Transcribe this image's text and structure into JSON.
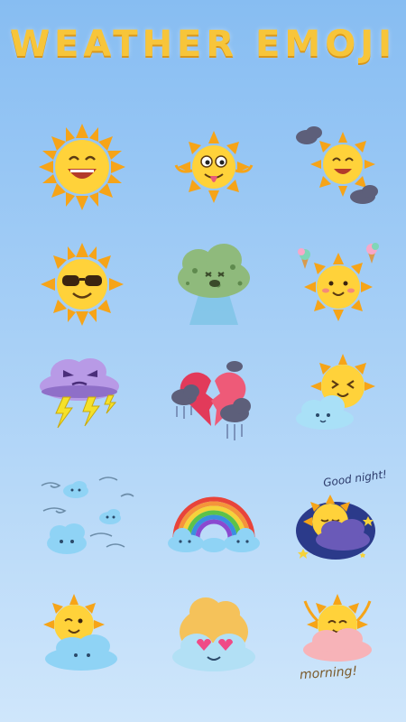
{
  "header": {
    "title": "WEATHER EMOJI"
  },
  "stickers": [
    {
      "name": "laughing-sun"
    },
    {
      "name": "silly-tongue-sun"
    },
    {
      "name": "sun-with-storm-clouds"
    },
    {
      "name": "cool-sunglasses-sun"
    },
    {
      "name": "sick-green-cloud"
    },
    {
      "name": "ice-cream-sun"
    },
    {
      "name": "angry-thunder-cloud"
    },
    {
      "name": "broken-heart-rain-clouds"
    },
    {
      "name": "sun-hugging-cloud"
    },
    {
      "name": "windy-clouds"
    },
    {
      "name": "rainbow-clouds"
    },
    {
      "name": "good-night-sun-cloud",
      "text": "Good night!"
    },
    {
      "name": "winking-sun-cloud"
    },
    {
      "name": "heart-eyes-cloud"
    },
    {
      "name": "good-morning-sun-cloud",
      "text": "morning!"
    }
  ],
  "colors": {
    "sun": "#f8b91c",
    "sun_face": "#ffd640",
    "title": "#f7c53a",
    "cloud_blue": "#8fd3f5",
    "storm_cloud": "#b89ae6",
    "green_cloud": "#8fba7c"
  }
}
